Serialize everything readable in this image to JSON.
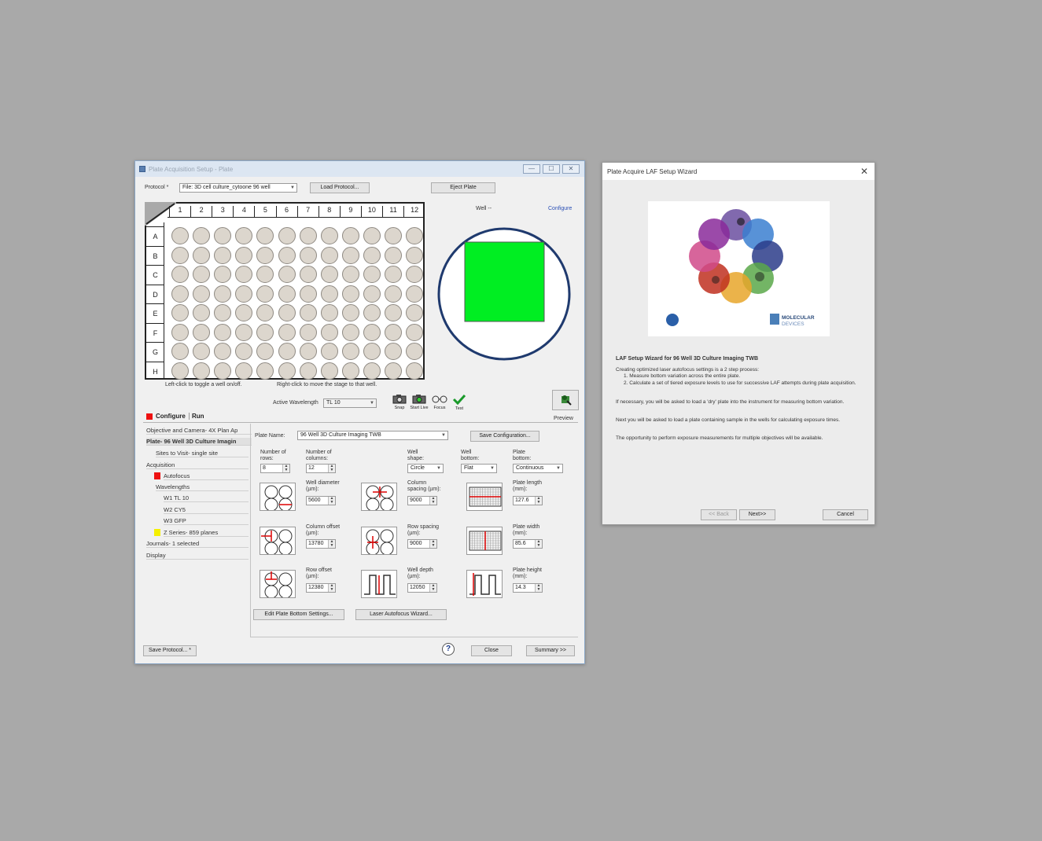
{
  "main_window": {
    "title": "Plate Acquisition Setup - Plate",
    "protocol_label": "Protocol *",
    "protocol_value": "File: 3D cell culture_cytoone 96 well",
    "load_protocol_button": "Load Protocol...",
    "eject_plate_button": "Eject Plate",
    "well_label": "Well --",
    "configure_link": "Configure",
    "plate": {
      "columns": [
        "1",
        "2",
        "3",
        "4",
        "5",
        "6",
        "7",
        "8",
        "9",
        "10",
        "11",
        "12"
      ],
      "rows": [
        "A",
        "B",
        "C",
        "D",
        "E",
        "F",
        "G",
        "H"
      ]
    },
    "hint_left": "Left-click to toggle a well on/off.",
    "hint_right": "Right-click to move the stage to that well.",
    "active_wavelength_label": "Active Wavelength",
    "active_wavelength_value": "TL 10",
    "tools": {
      "snap": "Snap",
      "start_live": "Start Live",
      "focus": "Focus",
      "test": "Test",
      "preview": "Preview"
    },
    "tabs": {
      "configure": "Configure",
      "run": "Run"
    },
    "tree": {
      "objective": "Objective and Camera- 4X Plan Ap",
      "plate": "Plate- 96 Well 3D Culture Imagin",
      "sites": "Sites to Visit- single site",
      "acquisition": "Acquisition",
      "autofocus": "Autofocus",
      "wavelengths": "Wavelengths",
      "w1": "W1 TL 10",
      "w2": "W2 CY5",
      "w3": "W3 GFP",
      "zseries": "Z Series- 859 planes",
      "journals": "Journals- 1 selected",
      "display": "Display"
    },
    "plate_panel": {
      "plate_name_label": "Plate Name:",
      "plate_name_value": "96 Well 3D Culture Imaging TWB",
      "save_configuration": "Save Configuration...",
      "rows_label": "Number of rows:",
      "rows_value": "8",
      "cols_label": "Number of columns:",
      "cols_value": "12",
      "well_shape_label": "Well shape:",
      "well_shape_value": "Circle",
      "well_bottom_label": "Well bottom:",
      "well_bottom_value": "Flat",
      "plate_bottom_label": "Plate bottom:",
      "plate_bottom_value": "Continuous",
      "well_diameter_label": "Well diameter (µm):",
      "well_diameter_value": "5600",
      "col_spacing_label": "Column spacing (µm):",
      "col_spacing_value": "9000",
      "plate_length_label": "Plate length (mm):",
      "plate_length_value": "127.6",
      "col_offset_label": "Column offset (µm):",
      "col_offset_value": "13780",
      "row_spacing_label": "Row spacing (µm):",
      "row_spacing_value": "9000",
      "plate_width_label": "Plate width (mm):",
      "plate_width_value": "85.6",
      "row_offset_label": "Row offset (µm):",
      "row_offset_value": "12380",
      "well_depth_label": "Well depth (µm):",
      "well_depth_value": "12050",
      "plate_height_label": "Plate height (mm):",
      "plate_height_value": "14.3",
      "edit_bottom_button": "Edit Plate Bottom Settings...",
      "laser_af_button": "Laser Autofocus Wizard..."
    },
    "save_protocol_button": "Save Protocol... *",
    "close_button": "Close",
    "summary_button": "Summary >>",
    "help_icon": "?"
  },
  "wizard_window": {
    "title": "Plate Acquire LAF Setup Wizard",
    "logo_text": "MOLECULAR DEVICES",
    "heading": "LAF Setup Wizard for 96 Well 3D Culture Imaging TWB",
    "p1": "Creating optimized laser autofocus settings is a 2 step process:",
    "step1": "1. Measure bottom variation across the entire plate.",
    "step2": "2. Calculate a set of tiered exposure levels to use for successive LAF attempts during plate acquisition.",
    "p2": "If necessary, you will be asked to load a 'dry' plate into the instrument for measuring bottom variation.",
    "p3": "Next you will be asked to load a plate containing sample in the wells for calculating exposure times.",
    "p4": "The opportunity to perform exposure measurements for multiple objectives will be available.",
    "back_button": "<< Back",
    "next_button": "Next>>",
    "cancel_button": "Cancel"
  },
  "colors": {
    "desktop": "#a9a9a9",
    "green_roi": "#00ee22",
    "well_circle": "#1f3a6e",
    "autofocus_red": "#ee1111",
    "zseries_yellow": "#f5f000",
    "link_blue": "#2a4fb5"
  }
}
